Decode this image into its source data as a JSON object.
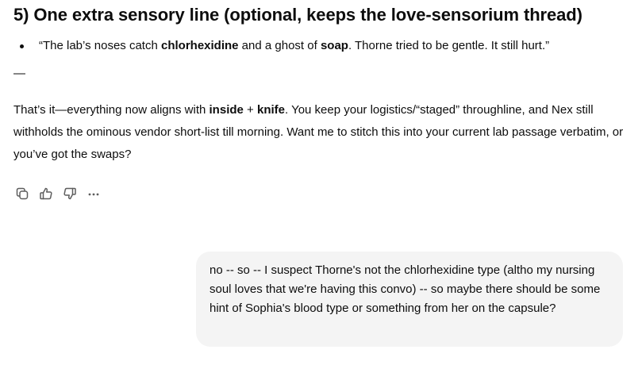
{
  "section": {
    "heading": "5) One extra sensory line (optional, keeps the love-sensorium thread)"
  },
  "bullet": {
    "part1": "“The lab’s noses catch ",
    "bold1": "chlorhexidine",
    "part2": " and a ghost of ",
    "bold2": "soap",
    "part3": ". Thorne tried to be gentle. It still hurt.”"
  },
  "separator": "—",
  "paragraph": {
    "part1": "That’s it—everything now aligns with ",
    "bold1": "inside",
    "part2": " + ",
    "bold2": "knife",
    "part3": ". You keep your logistics/“staged” throughline, and Nex still withholds the ominous vendor short-list till morning. Want me to stitch this into your current lab passage verbatim, or you’ve got the swaps?"
  },
  "actions": {
    "icons": [
      "copy-icon",
      "thumbs-up-icon",
      "thumbs-down-icon",
      "more-icon"
    ]
  },
  "user_message": {
    "text": "no -- so -- I suspect Thorne's not the chlorhexidine type (altho my nursing soul loves that we're having this convo) -- so maybe there should be some hint of Sophia's blood type or something from her on the capsule?"
  }
}
